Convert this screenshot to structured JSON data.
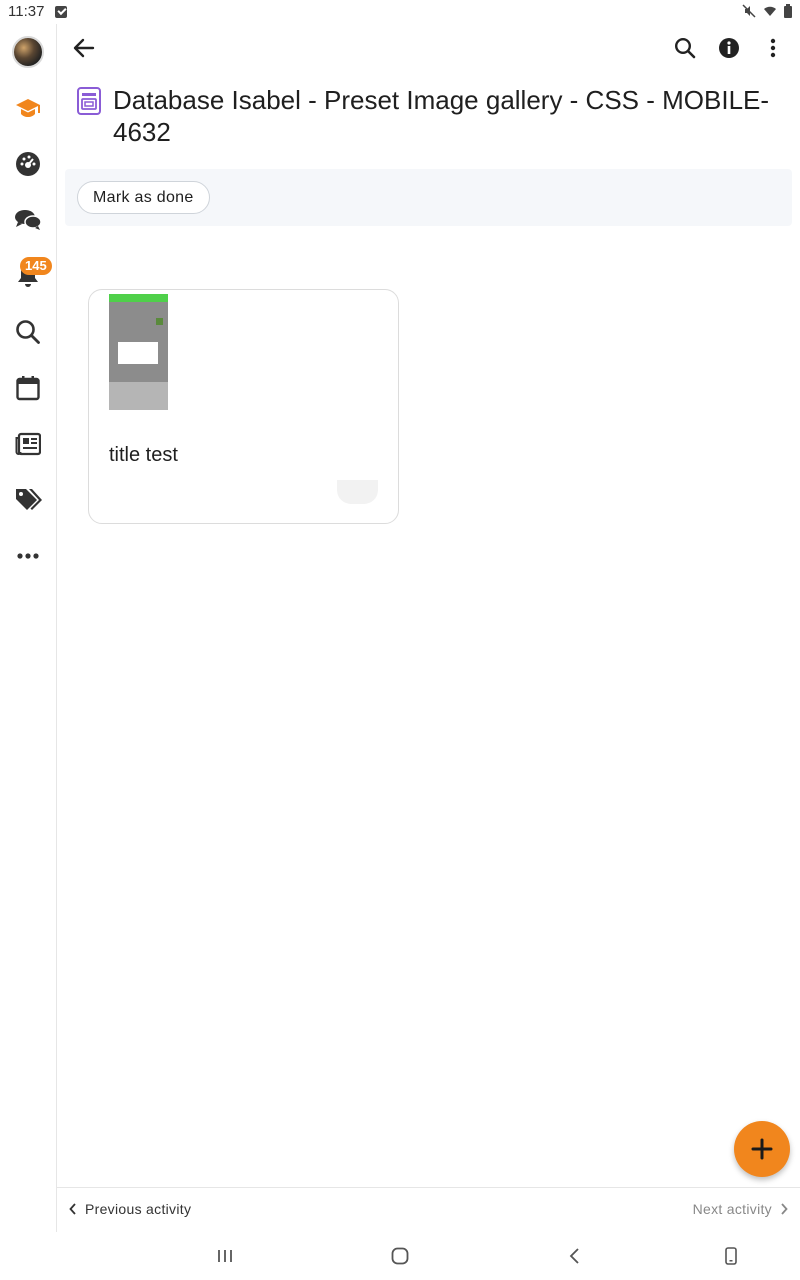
{
  "status_bar": {
    "time": "11:37"
  },
  "page": {
    "title": "Database Isabel - Preset Image gallery - CSS - MOBILE-4632",
    "mark_done_label": "Mark as done"
  },
  "rail": {
    "notifications_badge": "145"
  },
  "gallery": {
    "entries": [
      {
        "title": "title test"
      }
    ]
  },
  "footer": {
    "previous_label": "Previous activity",
    "next_label": "Next activity"
  },
  "colors": {
    "accent": "#f1861d",
    "title_icon": "#8a5cd6"
  },
  "icons": [
    "back-arrow-icon",
    "search-icon",
    "info-icon",
    "more-vert-icon",
    "graduation-cap-icon",
    "dashboard-icon",
    "chat-icon",
    "bell-icon",
    "calendar-icon",
    "news-icon",
    "tags-icon",
    "more-horiz-icon",
    "plus-icon"
  ]
}
